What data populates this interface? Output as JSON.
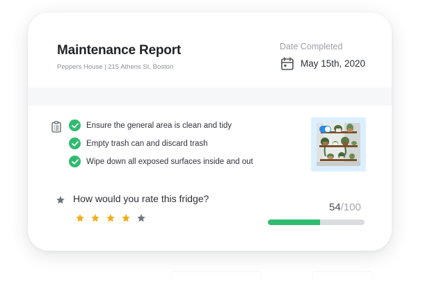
{
  "report": {
    "title": "Maintenance Report",
    "location": "Peppers House | 215 Athens St, Boston",
    "date_label": "Date Completed",
    "date_value": "May 15th, 2020"
  },
  "checklist": {
    "icon": "clipboard-icon",
    "items": [
      {
        "label": "Ensure the general area is clean and tidy",
        "done": true
      },
      {
        "label": "Empty trash can and discard trash",
        "done": true
      },
      {
        "label": "Wipe down all exposed surfaces inside and out",
        "done": true
      }
    ]
  },
  "photo": {
    "selected": true
  },
  "rating": {
    "question": "How would you rate this fridge?",
    "stars_filled": 4,
    "stars_total": 5,
    "score": "54",
    "score_max": "/100",
    "progress_fraction": 0.54
  },
  "colors": {
    "accent_green": "#2fbb6f",
    "star_gold": "#f3ac12",
    "star_grey": "#6e767d",
    "progress_track": "#d9dde0",
    "photo_tile_bg": "#dcefff",
    "toggle_blue": "#2b8be6"
  }
}
